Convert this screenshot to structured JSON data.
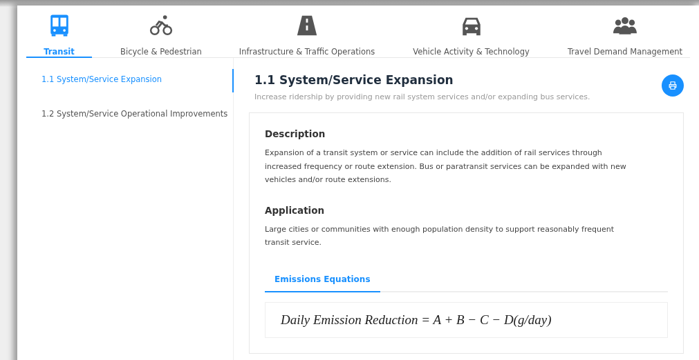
{
  "tabs": [
    {
      "label": "Transit",
      "kind": "bus",
      "selected": true
    },
    {
      "label": "Bicycle & Pedestrian",
      "kind": "bicycle",
      "selected": false
    },
    {
      "label": "Infrastructure & Traffic Operations",
      "kind": "road",
      "selected": false
    },
    {
      "label": "Vehicle Activity & Technology",
      "kind": "car",
      "selected": false
    },
    {
      "label": "Travel Demand Management",
      "kind": "people",
      "selected": false
    }
  ],
  "sidebar": {
    "items": [
      {
        "label": "1.1 System/Service Expansion",
        "selected": true
      },
      {
        "label": "1.2 System/Service Operational Improvements",
        "selected": false
      }
    ]
  },
  "content": {
    "title": "1.1 System/Service Expansion",
    "subtitle": "Increase ridership by providing new rail system services and/or expanding bus services.",
    "sections": [
      {
        "heading": "Description",
        "text": "Expansion of a transit system or service can include the addition of rail services through increased frequency or route extension. Bus or paratransit services can be expanded with new vehicles and/or route extensions."
      },
      {
        "heading": "Application",
        "text": "Large cities or communities with enough population density to support reasonably frequent transit service."
      }
    ],
    "inner_tabs": [
      {
        "label": "Emissions Equations",
        "selected": true
      }
    ],
    "equation": "Daily Emission Reduction = A + B − C − D(g/day)"
  }
}
